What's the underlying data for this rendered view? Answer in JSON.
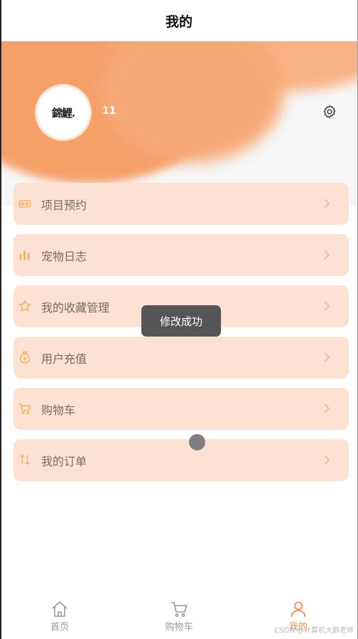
{
  "nav": {
    "title": "我的"
  },
  "profile": {
    "avatar_text": "錦鯉.",
    "username": "11"
  },
  "menu": [
    {
      "label": "项目预约",
      "icon": "vr-glasses-icon"
    },
    {
      "label": "宠物日志",
      "icon": "bar-chart-icon"
    },
    {
      "label": "我的收藏管理",
      "icon": "star-icon"
    },
    {
      "label": "用户充值",
      "icon": "money-bag-icon"
    },
    {
      "label": "购物车",
      "icon": "cart-icon"
    },
    {
      "label": "我的订单",
      "icon": "sort-arrows-icon"
    }
  ],
  "toast": {
    "text": "修改成功"
  },
  "tabs": [
    {
      "label": "首页",
      "icon": "home-icon",
      "active": false
    },
    {
      "label": "购物车",
      "icon": "cart-icon",
      "active": false
    },
    {
      "label": "我的",
      "icon": "user-icon",
      "active": true
    }
  ],
  "watermark": "CSDN @计算机大鹅老师",
  "colors": {
    "accent": "#f08a5a",
    "header_blob": "#f6a069",
    "menu_bg": "#fde2d4",
    "icon_orange": "#f4b060",
    "toast_bg": "#555555"
  }
}
